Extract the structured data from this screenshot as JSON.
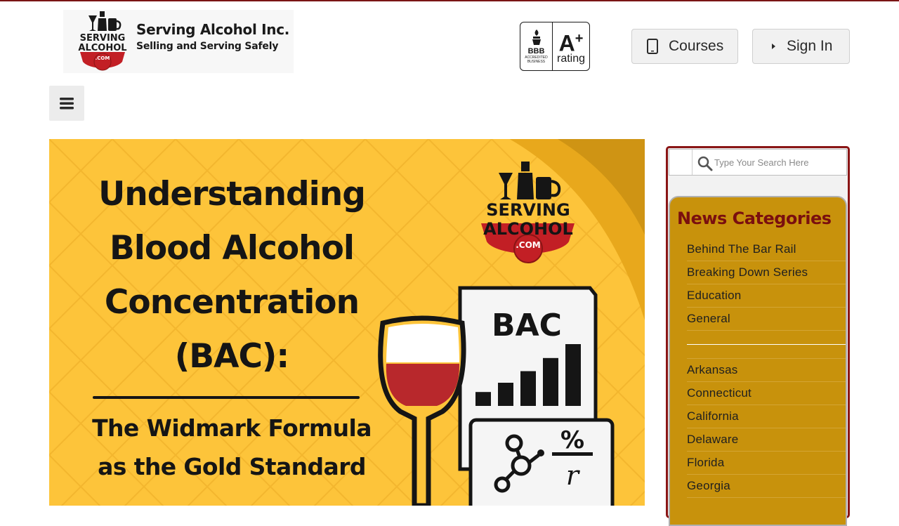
{
  "brand": {
    "logo_top": "SERVING",
    "logo_mid": "ALCOHOL",
    "logo_dotcom": ".COM",
    "name": "Serving Alcohol Inc.",
    "tagline": "Selling and Serving Safely"
  },
  "bbb_badge": {
    "abbr": "BBB",
    "sub_line1": "ACCREDITED",
    "sub_line2": "BUSINESS",
    "grade": "A",
    "grade_plus": "+",
    "rating_label": "rating"
  },
  "header": {
    "courses_label": "Courses",
    "signin_label": "Sign In"
  },
  "hero": {
    "title_line1": "Understanding",
    "title_line2": "Blood Alcohol",
    "title_line3": "Concentration",
    "title_line4": "(BAC):",
    "subtitle_line1": "The Widmark Formula",
    "subtitle_line2": "as the Gold Standard",
    "logo_line1": "SERVING",
    "logo_line2": "ALCOHOL",
    "logo_dotcom": ".COM",
    "chart_card_label": "BAC",
    "formula_top": "%",
    "formula_bottom": "r",
    "bar_levels": [
      0.18,
      0.3,
      0.45,
      0.62,
      0.8
    ]
  },
  "search": {
    "placeholder": "Type Your Search Here"
  },
  "categories": {
    "heading": "News Categories",
    "group1": [
      "Behind The Bar Rail",
      "Breaking Down Series",
      "Education",
      "General"
    ],
    "group2": [
      "Arkansas",
      "Connecticut",
      "California",
      "Delaware",
      "Florida",
      "Georgia"
    ]
  },
  "colors": {
    "brand_red": "#8a1515",
    "hero_yellow": "#fdc43a",
    "panel_gold": "#c8920c"
  }
}
